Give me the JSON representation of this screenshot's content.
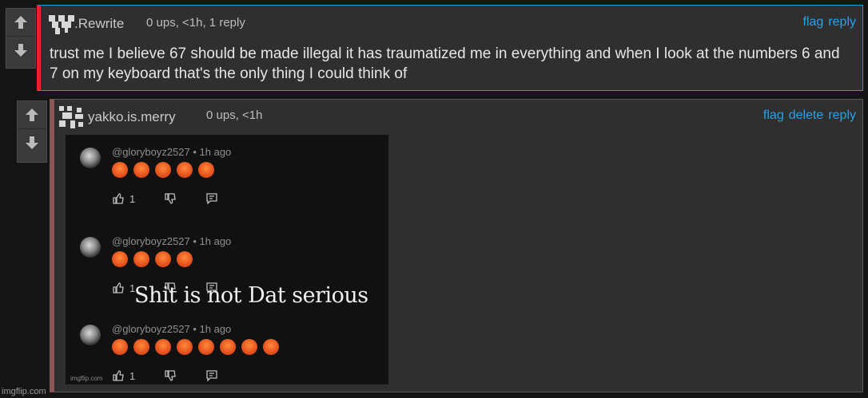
{
  "comment1": {
    "username": ".Rewrite",
    "meta": "0 ups, <1h, 1 reply",
    "actions": [
      "flag",
      "reply"
    ],
    "text": "trust me I believe 67 should be made illegal it has traumatized me in everything and when I look at the numbers 6 and 7 on my keyboard that's the only thing I could think of",
    "colors": {
      "accent_left": "#e0262c",
      "border": "#1f9fd0"
    }
  },
  "comment2": {
    "username": "yakko.is.merry",
    "meta": "0 ups, <1h",
    "actions": [
      "flag",
      "delete",
      "reply"
    ],
    "image": {
      "posts": [
        {
          "handle": "@gloryboyz2527 • 1h ago",
          "emoji_count": 5,
          "likes": "1"
        },
        {
          "handle": "@gloryboyz2527 • 1h ago",
          "emoji_count": 4,
          "likes": "1"
        },
        {
          "handle": "@gloryboyz2527 • 1h ago",
          "emoji_count": 8,
          "likes": "1"
        }
      ],
      "overlay_text": "Shit is not Dat serious",
      "watermark": "imgflip.com"
    }
  },
  "footer": {
    "watermark": "imgflip.com"
  },
  "icons": [
    "arrow-up-icon",
    "arrow-down-icon",
    "thumbs-up-icon",
    "thumbs-down-icon",
    "reply-icon",
    "angry-face-icon"
  ],
  "colors": {
    "link": "#27a3e8",
    "background": "#151515",
    "panel": "#2f2f2f"
  }
}
